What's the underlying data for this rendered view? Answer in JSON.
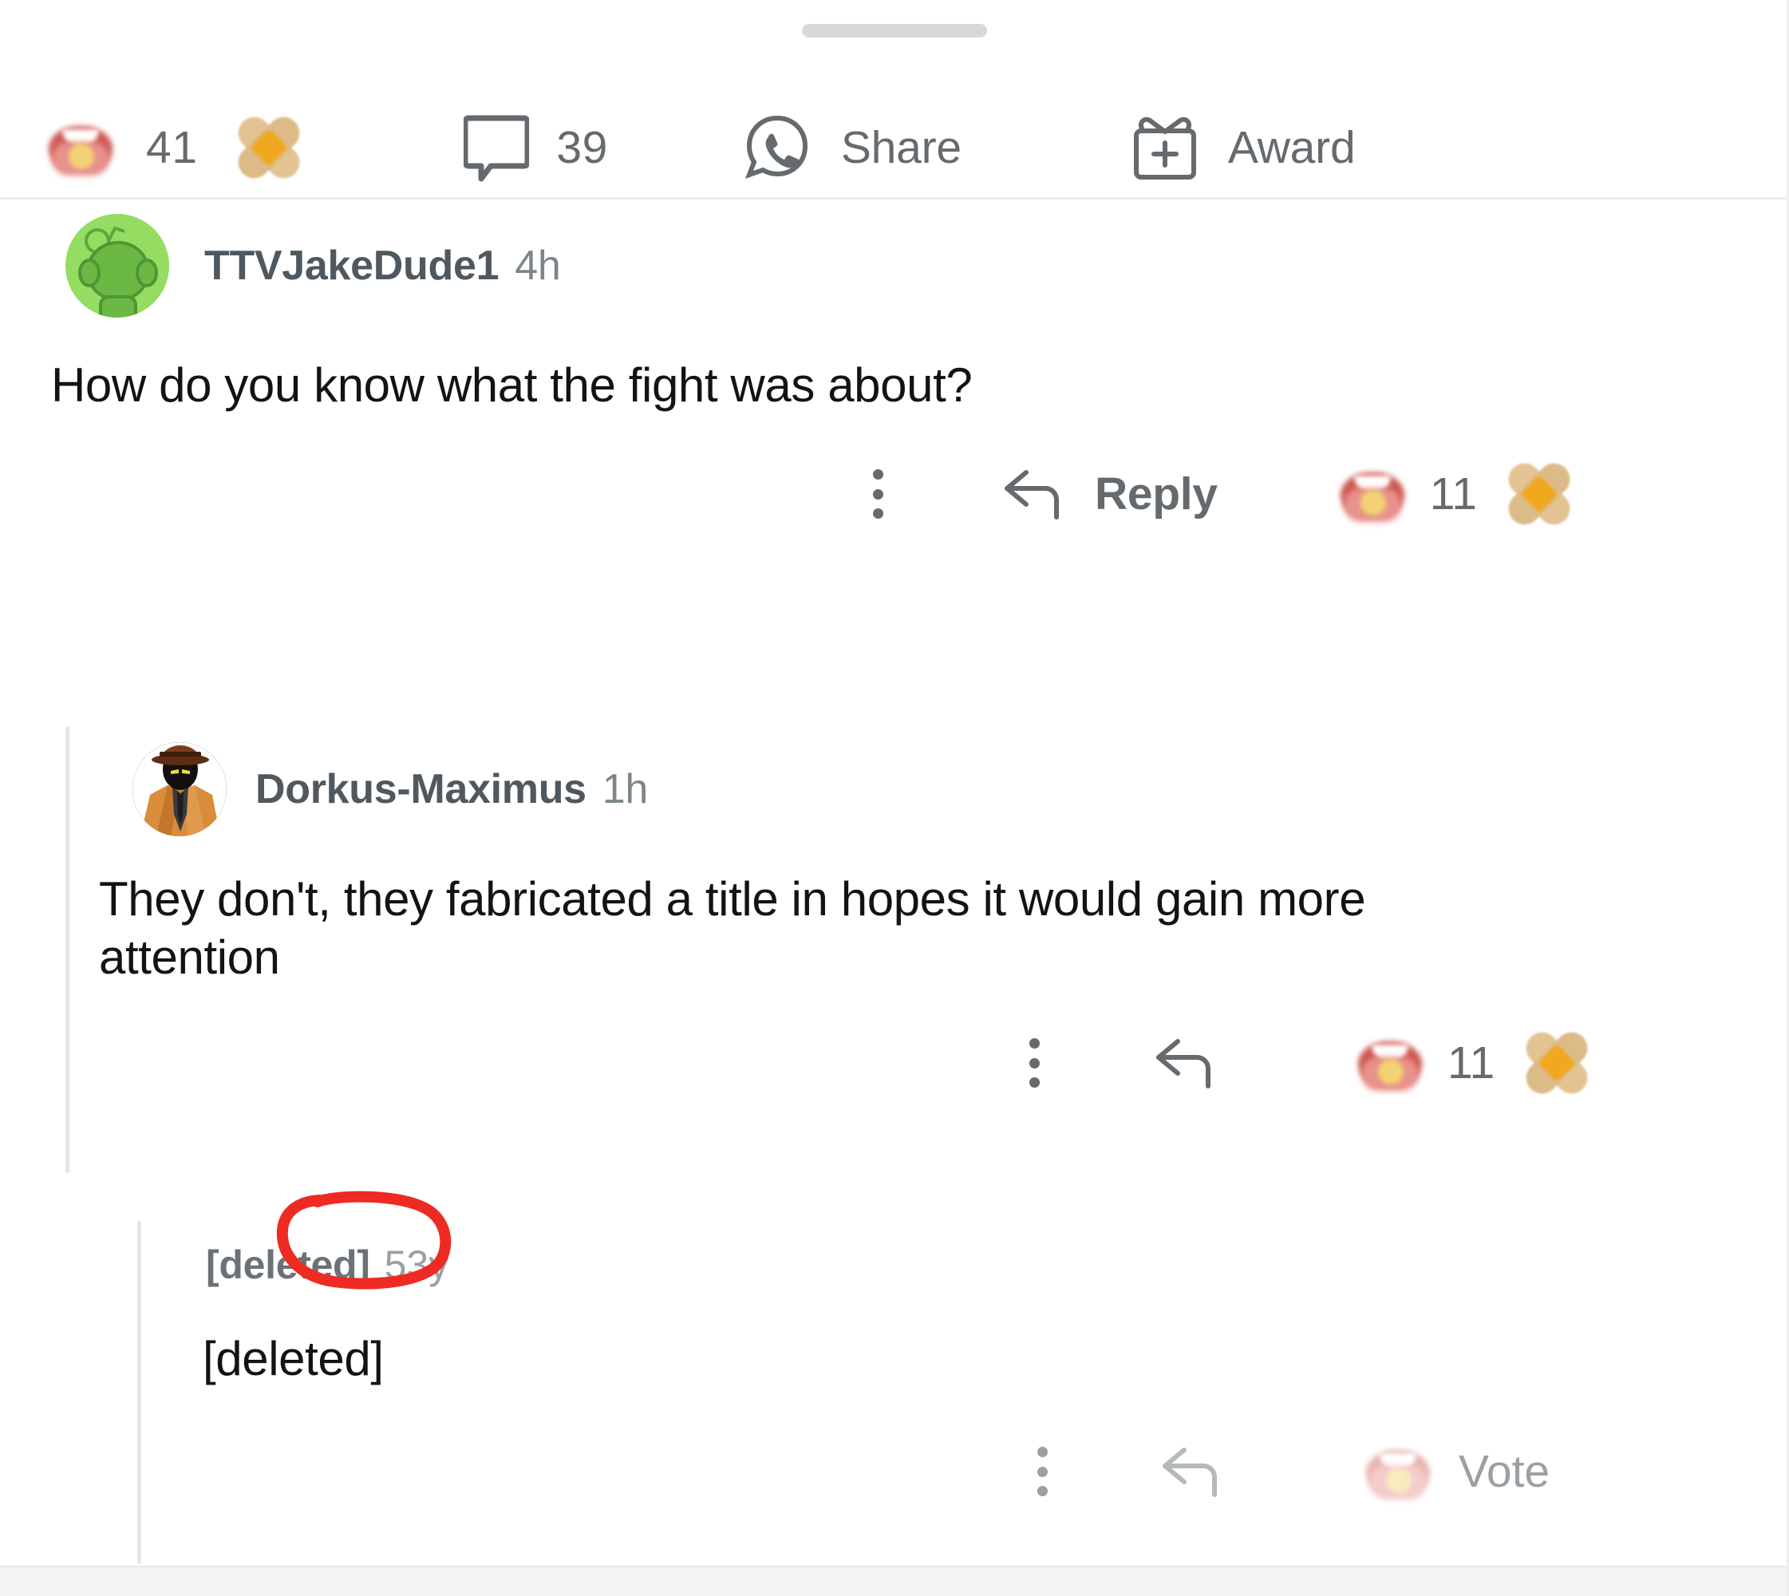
{
  "app": {
    "platform": "reddit",
    "view": "comment-thread-bottom-sheet"
  },
  "post_actions": {
    "upvote": {
      "icon": "censored-upvote-emoji",
      "count": "41"
    },
    "reaction": {
      "icon": "bandage-emoji"
    },
    "comments": {
      "icon": "comment-bubble-icon",
      "count": "39"
    },
    "share": {
      "icon": "whatsapp-share-icon",
      "label": "Share"
    },
    "award": {
      "icon": "gift-plus-icon",
      "label": "Award"
    }
  },
  "comments": [
    {
      "id": "c1",
      "username": "TTVJakeDude1",
      "timestamp": "4h",
      "avatar": "snoo-green-avatar",
      "body": "How do you know what the fight was about?",
      "actions": {
        "menu": "overflow-menu-icon",
        "reply_icon": "reply-arrow-icon",
        "reply_label": "Reply",
        "vote_icon": "censored-upvote-emoji",
        "vote_count": "11",
        "reaction_icon": "bandage-emoji"
      }
    },
    {
      "id": "c2",
      "username": "Dorkus-Maximus",
      "timestamp": "1h",
      "avatar": "detective-noir-avatar",
      "body": "They don't, they fabricated a title in hopes it would gain more attention",
      "actions": {
        "menu": "overflow-menu-icon",
        "reply_icon": "reply-arrow-icon",
        "reply_label": "",
        "vote_icon": "censored-upvote-emoji",
        "vote_count": "11",
        "reaction_icon": "bandage-emoji"
      }
    },
    {
      "id": "c3",
      "username": "[deleted]",
      "timestamp": "53y",
      "avatar": "none",
      "body": "[deleted]",
      "actions": {
        "menu": "overflow-menu-icon",
        "reply_icon": "reply-arrow-icon",
        "reply_label": "",
        "vote_icon": "censored-upvote-emoji-faded",
        "vote_count": "",
        "vote_label": "Vote"
      }
    }
  ],
  "annotation": {
    "type": "hand-drawn-circle",
    "color": "#ee2b23",
    "targets": "53y"
  },
  "colors": {
    "background": "#ffffff",
    "text_primary": "#111315",
    "text_secondary": "#646a6e",
    "text_muted": "#9aa0a4",
    "divider": "#eaecee",
    "thread_line": "#e4e6e8",
    "annotation_red": "#ee2b23",
    "avatar_green": "#94dd62",
    "bottom_strip": "#f1f3f5"
  }
}
